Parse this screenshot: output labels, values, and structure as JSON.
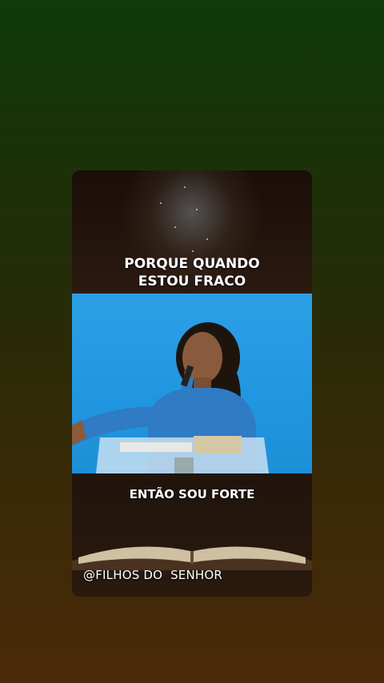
{
  "post": {
    "top_caption_line1": "PORQUE QUANDO",
    "top_caption_line2": "ESTOU FRACO",
    "middle_caption": "ENTÃO SOU FORTE",
    "watermark": "@FILHOS DO  SENHOR"
  },
  "colors": {
    "video_background": "#2196e0",
    "shirt": "#2f7bc4",
    "caption_text": "#ffffff"
  }
}
